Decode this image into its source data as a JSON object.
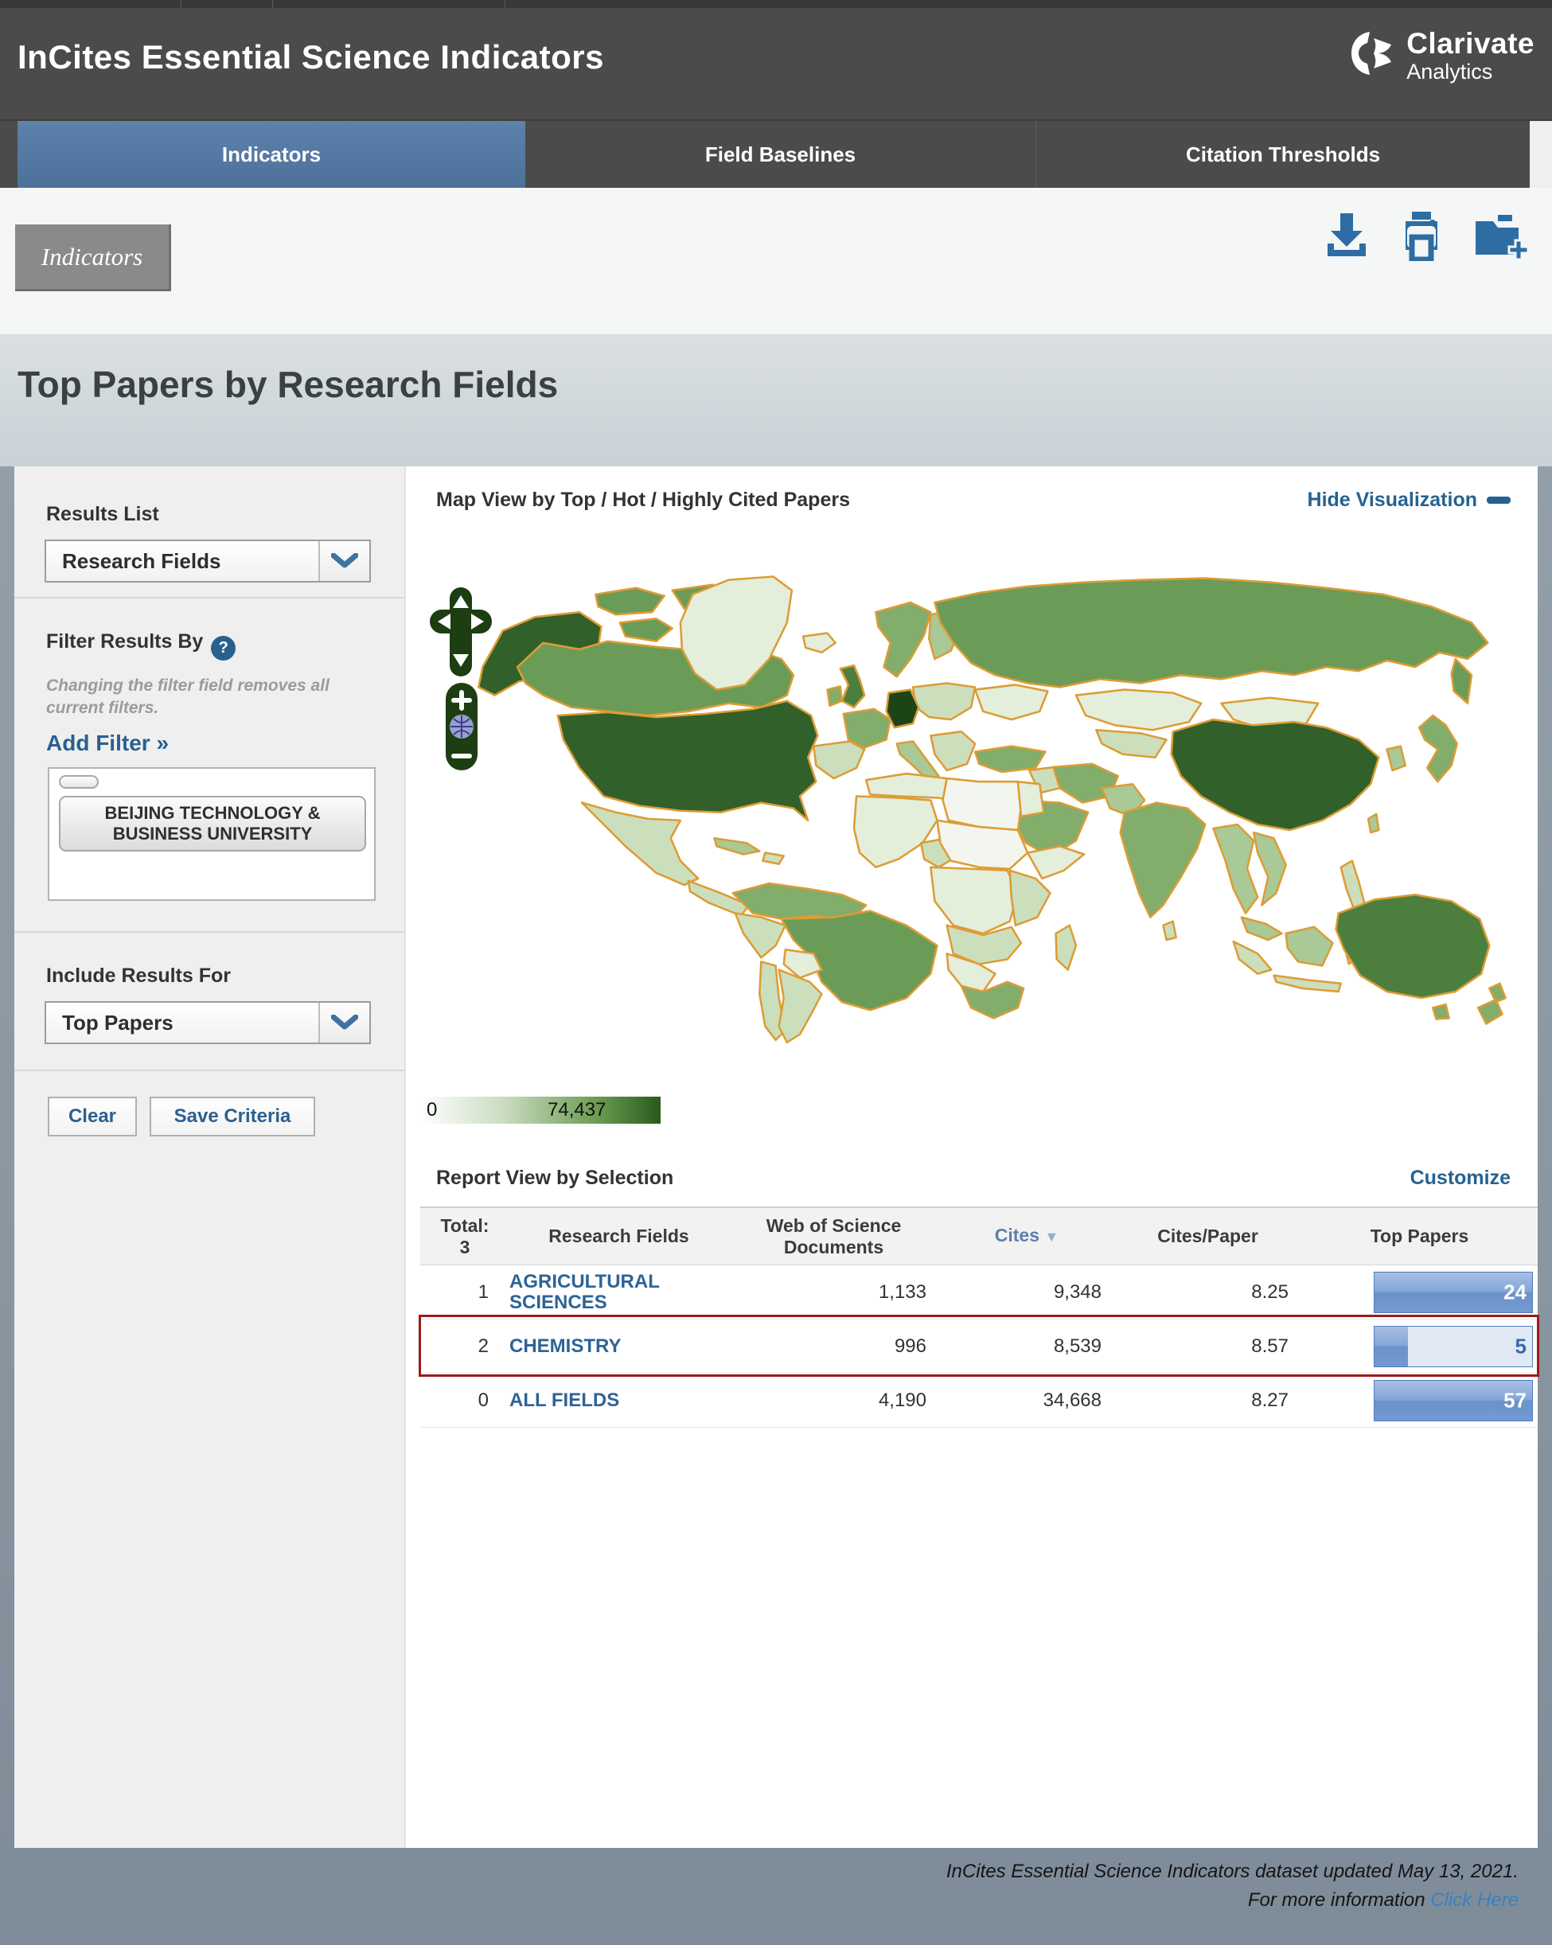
{
  "app": {
    "title": "InCites Essential Science Indicators",
    "brand": {
      "name": "Clarivate",
      "sub": "Analytics"
    }
  },
  "tabs": [
    {
      "label": "Indicators",
      "active": true
    },
    {
      "label": "Field Baselines",
      "active": false
    },
    {
      "label": "Citation Thresholds",
      "active": false
    }
  ],
  "toolbar": {
    "breadcrumb": "Indicators",
    "icons": [
      "download-icon",
      "print-icon",
      "folder-add-icon"
    ]
  },
  "page": {
    "title": "Top Papers by Research Fields"
  },
  "sidebar": {
    "results_list": {
      "label": "Results List",
      "value": "Research Fields"
    },
    "filter": {
      "label": "Filter Results By",
      "help": "?",
      "note": "Changing the filter field removes all current filters.",
      "add_filter": "Add Filter »",
      "chip": "BEIJING TECHNOLOGY & BUSINESS UNIVERSITY"
    },
    "include": {
      "label": "Include Results For",
      "value": "Top Papers"
    },
    "buttons": {
      "clear": "Clear",
      "save": "Save Criteria"
    }
  },
  "map": {
    "title": "Map View by Top / Hot / Highly Cited Papers",
    "hide_link": "Hide Visualization",
    "legend": {
      "min": "0",
      "max": "74,437"
    },
    "border_color": "#dd9c34",
    "palette": {
      "c0": "#f2f6ee",
      "c1": "#e3eedb",
      "c2": "#cbdfbd",
      "c3": "#a9c997",
      "c4": "#82ad6b",
      "c5": "#6b9c57",
      "c6": "#4c7f3d",
      "c7": "#31602a",
      "c8": "#1d4417"
    },
    "regions": [
      {
        "id": "alaska",
        "shade": "c7"
      },
      {
        "id": "canada",
        "shade": "c5"
      },
      {
        "id": "can-isl-1",
        "shade": "c5"
      },
      {
        "id": "can-isl-2",
        "shade": "c5"
      },
      {
        "id": "can-isl-3",
        "shade": "c5"
      },
      {
        "id": "can-isl-4",
        "shade": "c3"
      },
      {
        "id": "greenland",
        "shade": "c1"
      },
      {
        "id": "usa",
        "shade": "c7"
      },
      {
        "id": "mexico",
        "shade": "c2"
      },
      {
        "id": "camerica",
        "shade": "c2"
      },
      {
        "id": "cuba",
        "shade": "c3"
      },
      {
        "id": "hispaniola",
        "shade": "c2"
      },
      {
        "id": "sa-north",
        "shade": "c4"
      },
      {
        "id": "brazil",
        "shade": "c5"
      },
      {
        "id": "peru",
        "shade": "c2"
      },
      {
        "id": "bolivia",
        "shade": "c1"
      },
      {
        "id": "chile",
        "shade": "c2"
      },
      {
        "id": "argentina",
        "shade": "c2"
      },
      {
        "id": "iceland",
        "shade": "c1"
      },
      {
        "id": "uk",
        "shade": "c6"
      },
      {
        "id": "ireland",
        "shade": "c4"
      },
      {
        "id": "scandinavia",
        "shade": "c4"
      },
      {
        "id": "finland",
        "shade": "c3"
      },
      {
        "id": "iberia",
        "shade": "c2"
      },
      {
        "id": "france",
        "shade": "c4"
      },
      {
        "id": "germany",
        "shade": "c8"
      },
      {
        "id": "ceurope",
        "shade": "c2"
      },
      {
        "id": "italy",
        "shade": "c3"
      },
      {
        "id": "balkans",
        "shade": "c2"
      },
      {
        "id": "ukraine",
        "shade": "c1"
      },
      {
        "id": "turkey",
        "shade": "c4"
      },
      {
        "id": "russia",
        "shade": "c5"
      },
      {
        "id": "kamchatka",
        "shade": "c5"
      },
      {
        "id": "kazakhstan",
        "shade": "c1"
      },
      {
        "id": "centralasia",
        "shade": "c2"
      },
      {
        "id": "mongolia",
        "shade": "c1"
      },
      {
        "id": "china",
        "shade": "c7"
      },
      {
        "id": "india",
        "shade": "c4"
      },
      {
        "id": "pakistan",
        "shade": "c3"
      },
      {
        "id": "iran",
        "shade": "c4"
      },
      {
        "id": "iraq",
        "shade": "c2"
      },
      {
        "id": "saudi",
        "shade": "c4"
      },
      {
        "id": "egypt",
        "shade": "c1"
      },
      {
        "id": "maghreb",
        "shade": "c1"
      },
      {
        "id": "libya",
        "shade": "c0"
      },
      {
        "id": "westafrica",
        "shade": "c1"
      },
      {
        "id": "nigeria",
        "shade": "c2"
      },
      {
        "id": "sahel",
        "shade": "c0"
      },
      {
        "id": "horn",
        "shade": "c1"
      },
      {
        "id": "centralafrica",
        "shade": "c1"
      },
      {
        "id": "eastafrica",
        "shade": "c2"
      },
      {
        "id": "angola",
        "shade": "c2"
      },
      {
        "id": "namibia",
        "shade": "c1"
      },
      {
        "id": "southafrica",
        "shade": "c4"
      },
      {
        "id": "madagascar",
        "shade": "c2"
      },
      {
        "id": "myanmar",
        "shade": "c3"
      },
      {
        "id": "vietnam",
        "shade": "c3"
      },
      {
        "id": "malaysia",
        "shade": "c3"
      },
      {
        "id": "sumatra",
        "shade": "c2"
      },
      {
        "id": "java",
        "shade": "c2"
      },
      {
        "id": "borneo",
        "shade": "c3"
      },
      {
        "id": "sulawesi",
        "shade": "c2"
      },
      {
        "id": "newguinea",
        "shade": "c3"
      },
      {
        "id": "philippines",
        "shade": "c2"
      },
      {
        "id": "japan",
        "shade": "c4"
      },
      {
        "id": "korea",
        "shade": "c3"
      },
      {
        "id": "taiwan",
        "shade": "c3"
      },
      {
        "id": "srilanka",
        "shade": "c2"
      },
      {
        "id": "australia",
        "shade": "c6"
      },
      {
        "id": "tasmania",
        "shade": "c4"
      },
      {
        "id": "nz-north",
        "shade": "c4"
      },
      {
        "id": "nz-south",
        "shade": "c4"
      }
    ]
  },
  "report": {
    "title": "Report View by Selection",
    "customize": "Customize",
    "total_label": "Total:",
    "total_value": "3",
    "columns": {
      "field": "Research Fields",
      "docs": "Web of Science Documents",
      "cites": "Cites",
      "cpp": "Cites/Paper",
      "top": "Top Papers"
    },
    "sort": {
      "column": "Cites",
      "direction": "desc"
    },
    "rows": [
      {
        "rank": "1",
        "field": "AGRICULTURAL SCIENCES",
        "docs": "1,133",
        "cites": "9,348",
        "cpp": "8.25",
        "top": "24",
        "bar_pct": 100,
        "highlight": false
      },
      {
        "rank": "2",
        "field": "CHEMISTRY",
        "docs": "996",
        "cites": "8,539",
        "cpp": "8.57",
        "top": "5",
        "bar_pct": 21,
        "highlight": true
      },
      {
        "rank": "0",
        "field": "ALL FIELDS",
        "docs": "4,190",
        "cites": "34,668",
        "cpp": "8.27",
        "top": "57",
        "bar_pct": 100,
        "highlight": false
      }
    ]
  },
  "footer": {
    "line1": "InCites Essential Science Indicators dataset updated May 13, 2021.",
    "line2": "For more information",
    "link": "Click Here"
  }
}
